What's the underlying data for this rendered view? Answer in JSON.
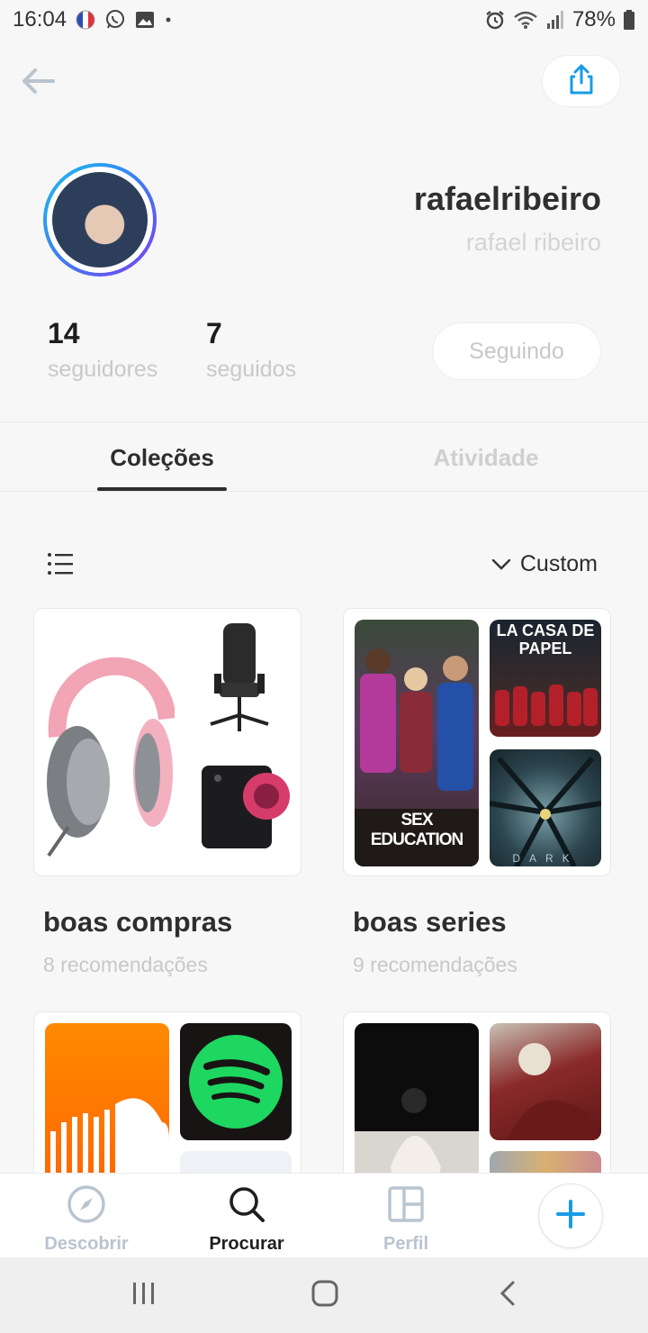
{
  "status_bar": {
    "time": "16:04",
    "battery": "78%",
    "left_icons": [
      "french-flag-icon",
      "whatsapp-icon",
      "gallery-icon",
      "dot-icon"
    ],
    "right_icons": [
      "alarm-icon",
      "wifi-icon",
      "signal-icon",
      "battery-icon"
    ]
  },
  "header": {
    "back_icon": "arrow-left-icon",
    "share_icon": "share-icon"
  },
  "profile": {
    "username": "rafaelribeiro",
    "full_name": "rafael ribeiro",
    "followers_count": "14",
    "followers_label": "seguidores",
    "following_count": "7",
    "following_label": "seguidos",
    "follow_button_label": "Seguindo"
  },
  "tabs": [
    {
      "label": "Coleções",
      "active": true
    },
    {
      "label": "Atividade",
      "active": false
    }
  ],
  "controls": {
    "sort_label": "Custom",
    "list_icon": "list-icon",
    "sort_icon": "chevron-down-icon"
  },
  "collections": [
    {
      "title": "boas compras",
      "subtitle": "8 recomendações"
    },
    {
      "title": "boas series",
      "subtitle": "9 recomendações",
      "thumb_texts": [
        "SEX EDUCATION",
        "LA CASA DE PAPEL",
        "DARK"
      ]
    },
    {
      "title": "",
      "subtitle": ""
    },
    {
      "title": "",
      "subtitle": ""
    }
  ],
  "bottom_nav": [
    {
      "label": "Descobrir",
      "icon": "compass-icon",
      "active": false
    },
    {
      "label": "Procurar",
      "icon": "search-icon",
      "active": true
    },
    {
      "label": "Perfil",
      "icon": "layout-icon",
      "active": false
    }
  ],
  "fab_icon": "plus-icon",
  "colors": {
    "accent": "#1a9be6",
    "inactive": "#b9c4cf",
    "avatar_ring_start": "#19c0ee",
    "avatar_ring_end": "#7b3ff2"
  }
}
